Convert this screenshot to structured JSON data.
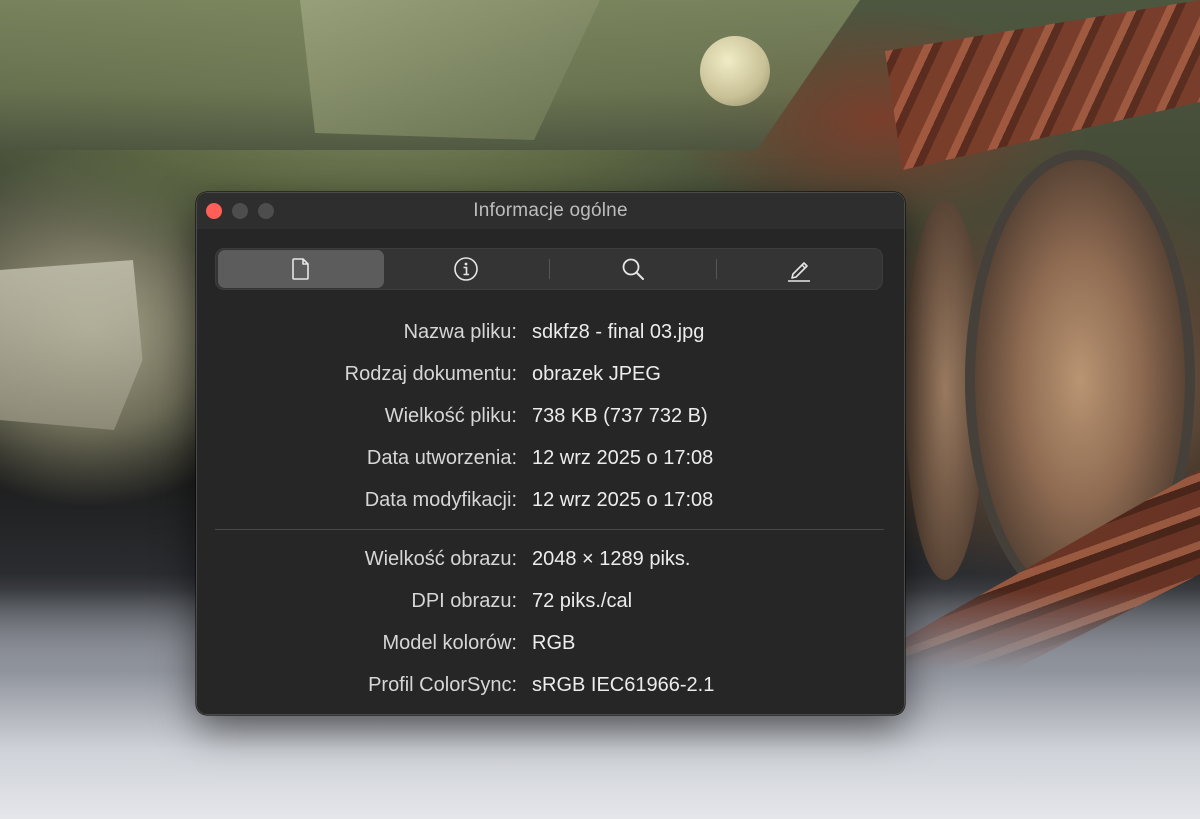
{
  "window": {
    "title": "Informacje ogólne",
    "traffic_colors": [
      "#ff5f57",
      "#4d4d4d",
      "#4d4d4d"
    ]
  },
  "toolbar": {
    "tabs": [
      {
        "icon": "document-icon",
        "active": true
      },
      {
        "icon": "info-circle-icon",
        "active": false
      },
      {
        "icon": "magnifier-icon",
        "active": false
      },
      {
        "icon": "pencil-icon",
        "active": false
      }
    ]
  },
  "file_info": [
    {
      "label": "Nazwa pliku:",
      "value": "sdkfz8 - final 03.jpg"
    },
    {
      "label": "Rodzaj dokumentu:",
      "value": "obrazek JPEG"
    },
    {
      "label": "Wielkość pliku:",
      "value": "738 KB (737 732 B)"
    },
    {
      "label": "Data utworzenia:",
      "value": "12 wrz 2025 o 17:08"
    },
    {
      "label": "Data modyfikacji:",
      "value": "12 wrz 2025 o 17:08"
    }
  ],
  "image_info": [
    {
      "label": "Wielkość obrazu:",
      "value": "2048 × 1289 piks."
    },
    {
      "label": "DPI obrazu:",
      "value": "72 piks./cal"
    },
    {
      "label": "Model kolorów:",
      "value": "RGB"
    },
    {
      "label": "Profil ColorSync:",
      "value": "sRGB IEC61966-2.1"
    }
  ]
}
